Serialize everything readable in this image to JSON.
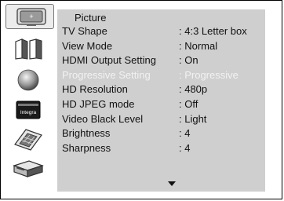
{
  "panel": {
    "title": "Picture",
    "rows": [
      {
        "label": "TV Shape",
        "value": ": 4:3 Letter box",
        "enabled": true
      },
      {
        "label": "View Mode",
        "value": ": Normal",
        "enabled": true
      },
      {
        "label": "HDMI Output Setting",
        "value": ": On",
        "enabled": true
      },
      {
        "label": "Progressive Setting",
        "value": ": Progressive",
        "enabled": false
      },
      {
        "label": "HD Resolution",
        "value": ": 480p",
        "enabled": true
      },
      {
        "label": "HD JPEG mode",
        "value": ": Off",
        "enabled": true
      },
      {
        "label": "Video Black Level",
        "value": ": Light",
        "enabled": true
      },
      {
        "label": "Brightness",
        "value": ": 4",
        "enabled": true
      },
      {
        "label": "Sharpness",
        "value": ": 4",
        "enabled": true
      }
    ],
    "more_indicator": "chevron-down-icon"
  },
  "sidebar": {
    "icons": [
      {
        "name": "tv-picture-icon",
        "selected": true,
        "glyph": "+"
      },
      {
        "name": "speakers-icon",
        "selected": false
      },
      {
        "name": "disc-icon",
        "selected": false
      },
      {
        "name": "integra-receiver-icon",
        "selected": false,
        "brand": "Integra"
      },
      {
        "name": "keyboard-icon",
        "selected": false
      },
      {
        "name": "player-device-icon",
        "selected": false
      }
    ]
  },
  "colors": {
    "panel_bg": "#cfcfcf",
    "disabled_text": "#f2f2f2",
    "text": "#111111"
  }
}
